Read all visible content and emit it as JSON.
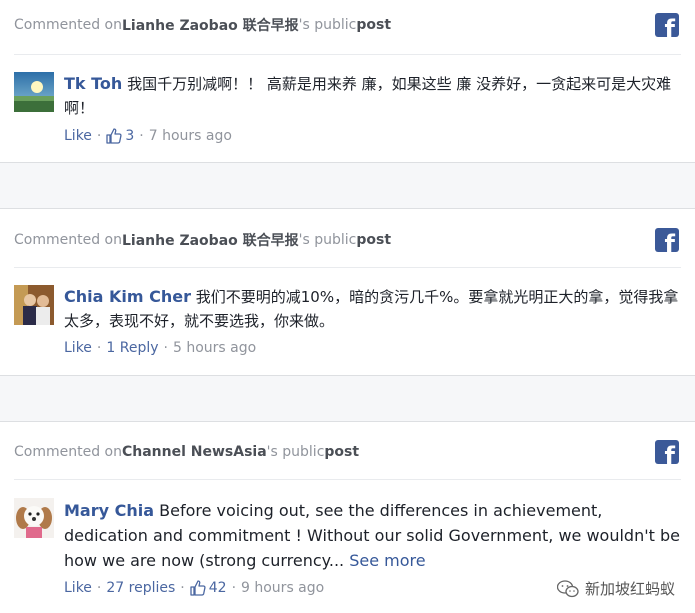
{
  "posts": [
    {
      "header": {
        "prefix": "Commented on ",
        "page": "Lianhe Zaobao 联合早报",
        "suffix": "'s public ",
        "post": "post"
      },
      "comment": {
        "author": "Tk Toh",
        "text": "我国千万别减啊！！ 高薪是用来养 廉，如果这些 廉 没养好，一贪起来可是大灾难啊！",
        "see_more": "",
        "actions": {
          "like": "Like",
          "replies": "",
          "likes": "3",
          "time": "7 hours ago"
        }
      }
    },
    {
      "header": {
        "prefix": "Commented on ",
        "page": "Lianhe Zaobao 联合早报",
        "suffix": "'s public ",
        "post": "post"
      },
      "comment": {
        "author": "Chia Kim Cher",
        "text": "我们不要明的减10%，暗的贪污几千%。要拿就光明正大的拿，觉得我拿太多，表现不好，就不要选我，你来做。",
        "see_more": "",
        "actions": {
          "like": "Like",
          "replies": "1 Reply",
          "likes": "",
          "time": "5 hours ago"
        }
      }
    },
    {
      "header": {
        "prefix": "Commented on ",
        "page": "Channel NewsAsia",
        "suffix": "'s public ",
        "post": "post"
      },
      "comment": {
        "author": "Mary Chia",
        "text": "Before voicing out, see the differences in achievement, dedication and commitment ! Without our solid Government, we wouldn't be how we are now (strong currency...",
        "see_more": "See more",
        "actions": {
          "like": "Like",
          "replies": "27 replies",
          "likes": "42",
          "time": "9 hours ago"
        }
      }
    }
  ],
  "facebook_logo": "f",
  "watermark": {
    "text": "新加坡红蚂蚁",
    "icon": "wechat-icon"
  },
  "colors": {
    "link": "#365899",
    "facebook": "#3b5998",
    "muted": "#90949c",
    "gap": "#f6f7f9"
  }
}
